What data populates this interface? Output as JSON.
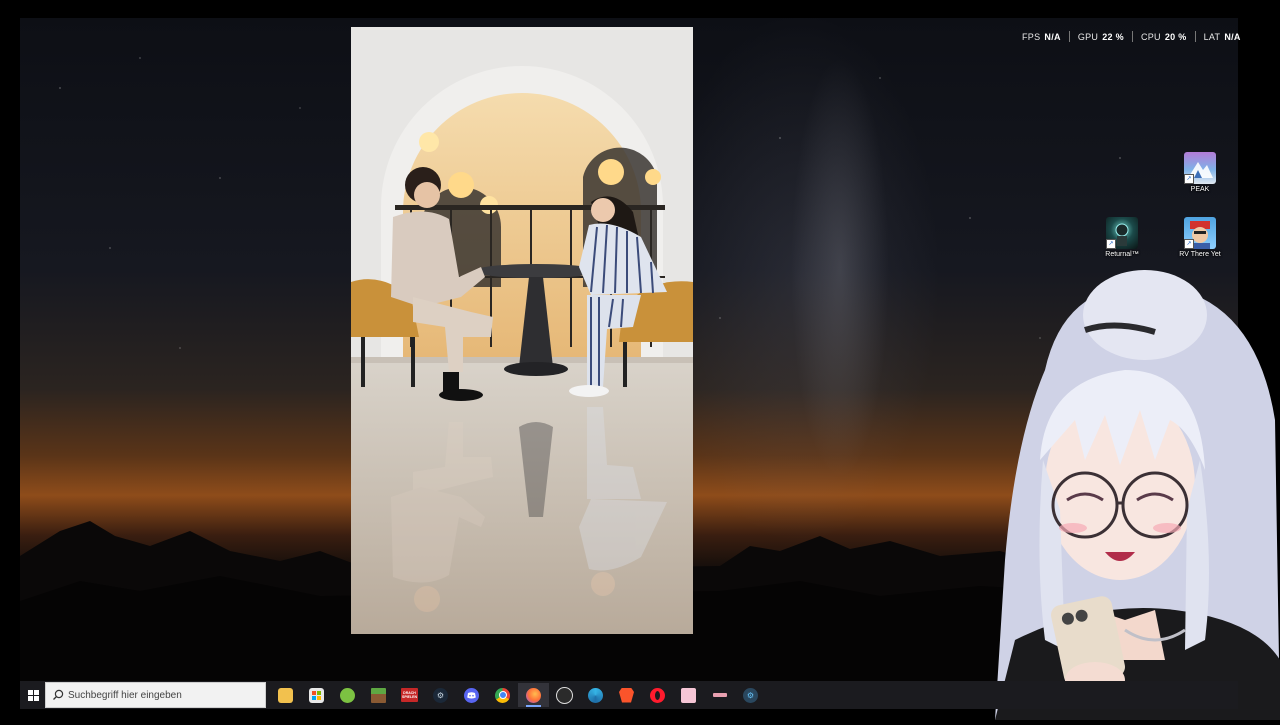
{
  "perf_overlay": [
    {
      "label": "FPS",
      "value": "N/A"
    },
    {
      "label": "GPU",
      "value": "22 %"
    },
    {
      "label": "CPU",
      "value": "20 %"
    },
    {
      "label": "LAT",
      "value": "N/A"
    }
  ],
  "desktop_icons": {
    "peak": "PEAK",
    "returnal": "Returnal™",
    "rv": "RV There Yet"
  },
  "taskbar": {
    "search_placeholder": "Suchbegriff hier eingeben",
    "icons": [
      "file-explorer",
      "microsoft-store",
      "android-app",
      "minecraft",
      "marquee-app",
      "steam",
      "discord",
      "chrome",
      "firefox",
      "obs-studio",
      "app-swirl",
      "brave",
      "opera-gx",
      "image-viewer",
      "remote-app",
      "steam-client"
    ],
    "marquee_text": "DRACH\nSPIELEN"
  },
  "colors": {
    "taskbar": "#1b1b1f",
    "search_bg": "#f2f2f2",
    "active_indicator": "#7aa7ff"
  }
}
